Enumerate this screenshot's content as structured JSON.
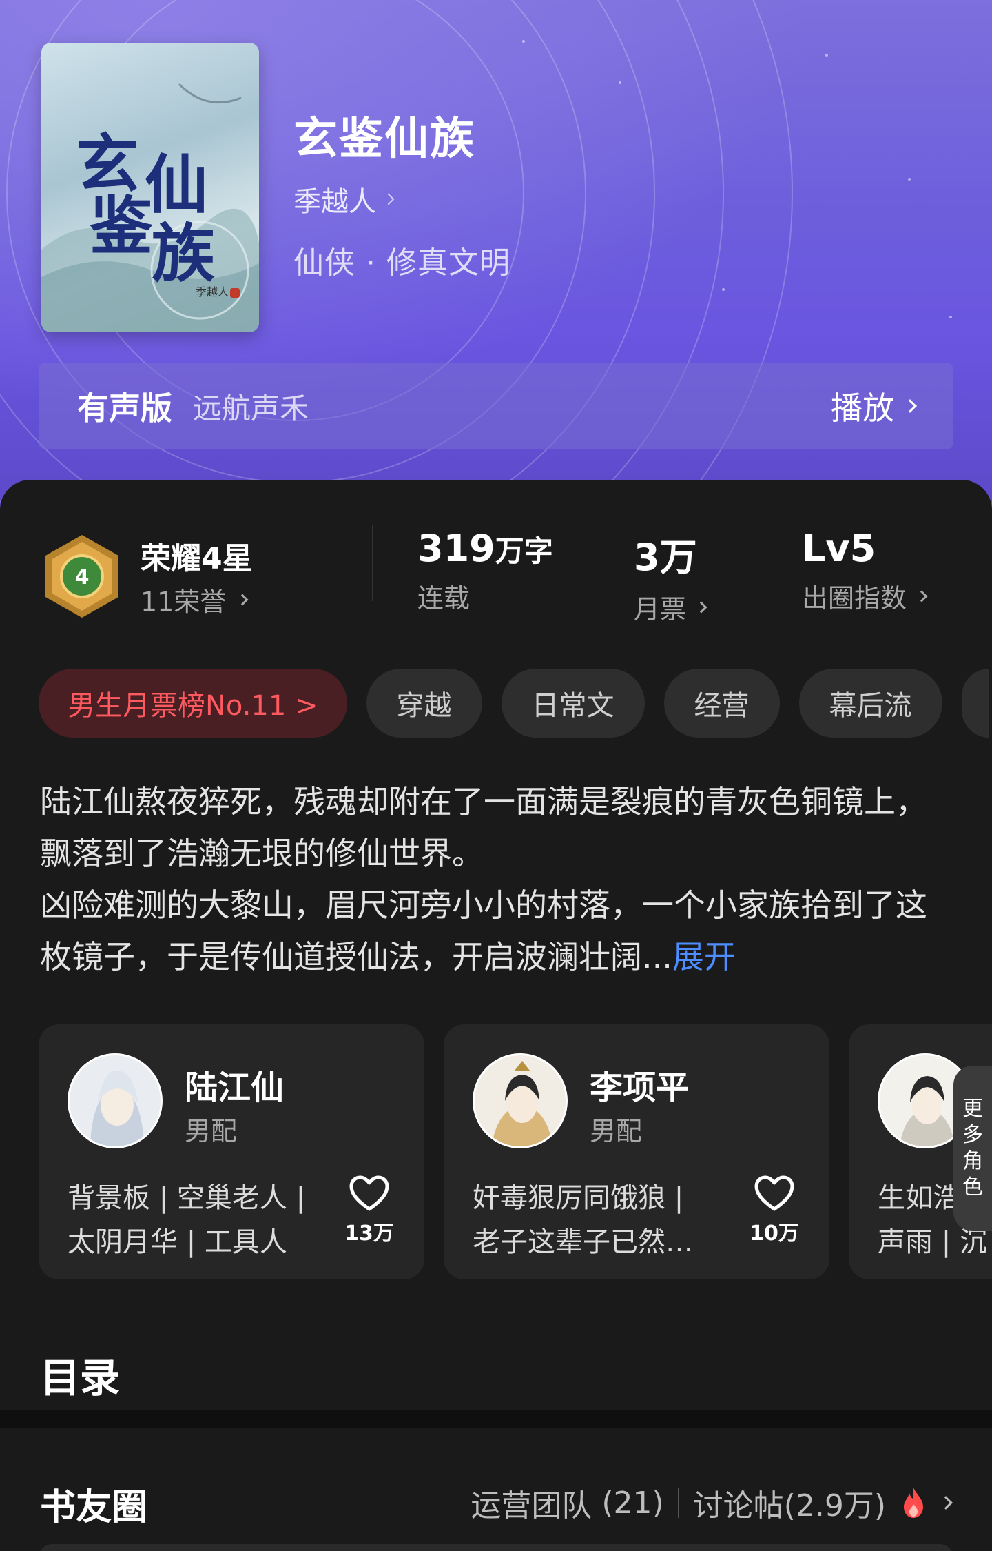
{
  "book": {
    "title": "玄鉴仙族",
    "author": "季越人",
    "genre": "仙侠 · 修真文明",
    "cover": {
      "chars": [
        "玄",
        "鉴",
        "仙",
        "族"
      ],
      "author_mark": "季越人"
    }
  },
  "audio": {
    "label": "有声版",
    "narrator": "远航声禾",
    "play_label": "播放"
  },
  "stats": {
    "honor_badge_level": "4",
    "honor_title": "荣耀4星",
    "honor_count": "11荣誉",
    "words_number": "319",
    "words_unit": "万字",
    "words_status": "连载",
    "monthly_votes": "3万",
    "monthly_votes_label": "月票",
    "level": "Lv5",
    "level_label": "出圈指数"
  },
  "tags": [
    "男生月票榜No.11 >",
    "穿越",
    "日常文",
    "经营",
    "幕后流"
  ],
  "description": {
    "text": "陆江仙熬夜猝死，残魂却附在了一面满是裂痕的青灰色铜镜上，飘落到了浩瀚无垠的修仙世界。\n凶险难测的大黎山，眉尺河旁小小的村落，一个小家族拾到了这枚镜子，于是传仙道授仙法，开启波澜壮阔...",
    "more_label": "展开"
  },
  "characters": [
    {
      "name": "陆江仙",
      "role": "男配",
      "desc_line1": "背景板 | 空巢老人 |",
      "desc_line2": "太阴月华 | 工具人",
      "likes": "13万"
    },
    {
      "name": "李项平",
      "role": "男配",
      "desc_line1": "奸毒狠厉同饿狼 |",
      "desc_line2": "老子这辈子已然…",
      "likes": "10万"
    },
    {
      "name": "",
      "role": "",
      "desc_line1": "生如浩瀚",
      "desc_line2": "声雨 | 沉",
      "likes": ""
    }
  ],
  "more_characters": [
    "更",
    "多",
    "角",
    "色"
  ],
  "toc": {
    "title": "目录"
  },
  "club": {
    "title": "书友圈",
    "team_label": "运营团队",
    "team_count": "(21)",
    "discussion_label": "讨论帖",
    "discussion_count": "(2.9万)"
  },
  "colors": {
    "hero_purple": "#6a55e0",
    "panel_bg": "#1a1a1a",
    "rank_tag_bg": "#4a1f23",
    "rank_tag_text": "#ff5a60",
    "link_blue": "#4d8dff",
    "fire": "#ff4b4b"
  }
}
